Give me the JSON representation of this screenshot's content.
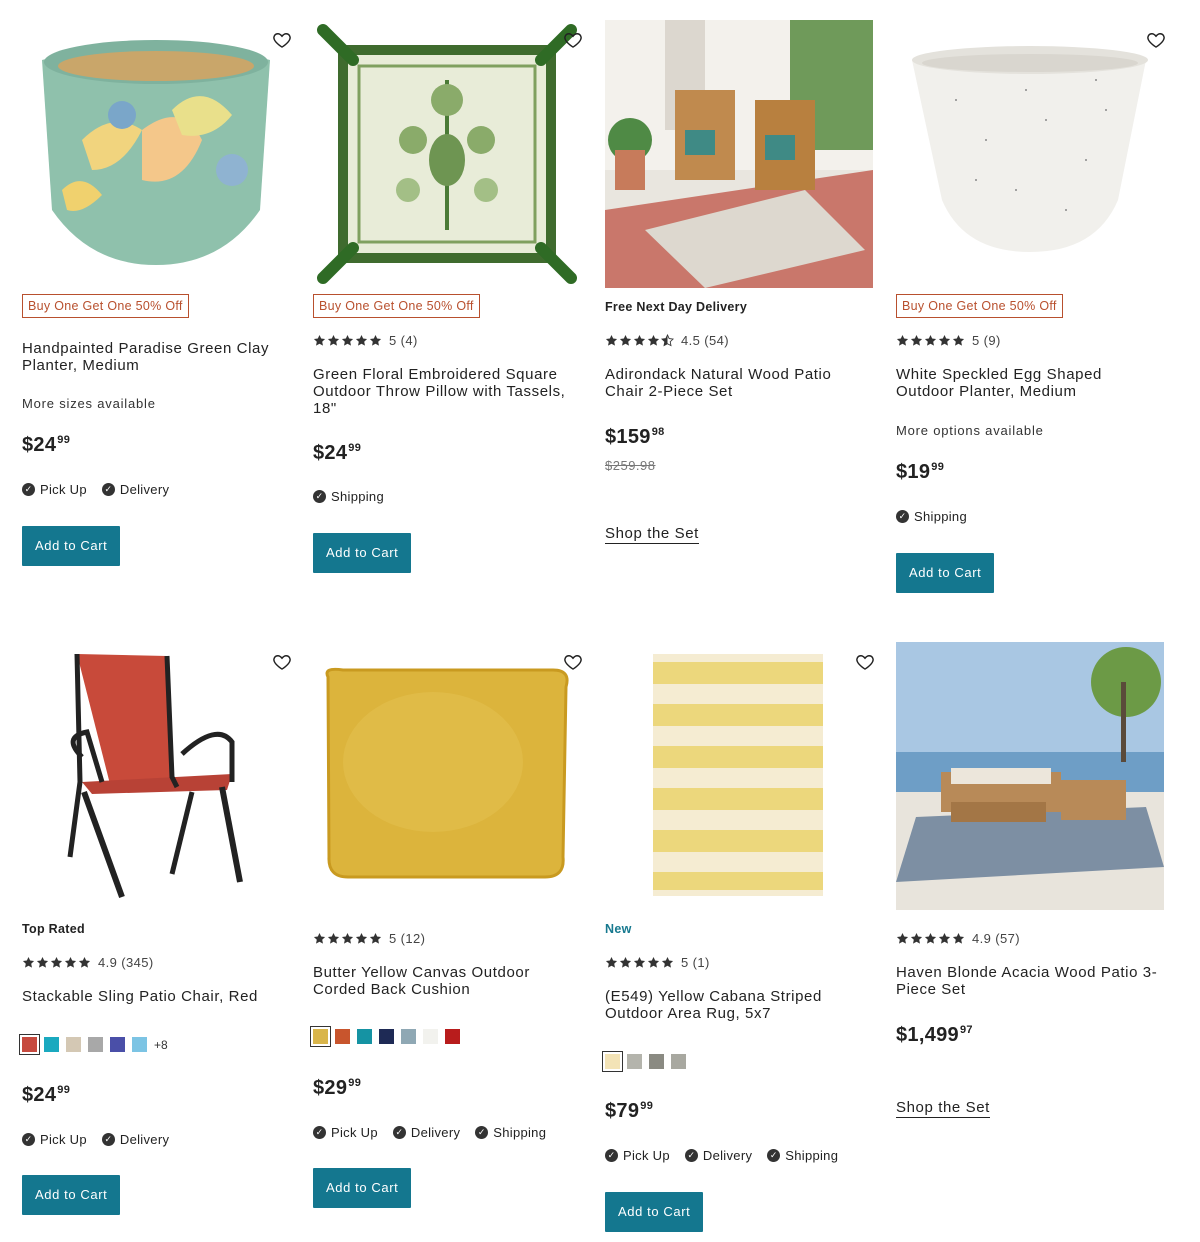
{
  "accent": "#14778f",
  "products": [
    {
      "badge": "Buy One Get One 50% Off",
      "title": "Handpainted Paradise Green Clay Planter, Medium",
      "sub": "More sizes available",
      "price_main": "$24",
      "price_cents": "99",
      "opts": [
        "Pick Up",
        "Delivery"
      ],
      "btn": "Add to Cart",
      "icon": "heart-icon"
    },
    {
      "badge": "Buy One Get One 50% Off",
      "rating_text": "5 (4)",
      "rating": 5,
      "title": "Green Floral Embroidered Square Outdoor Throw Pillow with Tassels, 18\"",
      "price_main": "$24",
      "price_cents": "99",
      "opts": [
        "Shipping"
      ],
      "btn": "Add to Cart",
      "icon": "heart-icon"
    },
    {
      "tag": "Free Next Day Delivery",
      "rating_text": "4.5 (54)",
      "rating": 4.5,
      "title": "Adirondack Natural Wood Patio Chair 2-Piece Set",
      "price_main": "$159",
      "price_cents": "98",
      "old_price": "$259.98",
      "link": "Shop the Set"
    },
    {
      "badge": "Buy One Get One 50% Off",
      "rating_text": "5 (9)",
      "rating": 5,
      "title": "White Speckled Egg Shaped Outdoor Planter, Medium",
      "sub": "More options available",
      "price_main": "$19",
      "price_cents": "99",
      "opts": [
        "Shipping"
      ],
      "btn": "Add to Cart",
      "icon": "heart-icon"
    },
    {
      "tag": "Top Rated",
      "rating_text": "4.9 (345)",
      "rating": 5,
      "title": "Stackable Sling Patio Chair, Red",
      "swatches": [
        "#c64a3f",
        "#1aa9bf",
        "#d4c8b4",
        "#a8a8a8",
        "#4a4fa8",
        "#7cc4e4"
      ],
      "more": "+8",
      "price_main": "$24",
      "price_cents": "99",
      "opts": [
        "Pick Up",
        "Delivery"
      ],
      "btn": "Add to Cart",
      "icon": "heart-icon"
    },
    {
      "rating_text": "5 (12)",
      "rating": 5,
      "title": "Butter Yellow Canvas Outdoor Corded Back Cushion",
      "swatches": [
        "#d9b54a",
        "#c8552d",
        "#1593a3",
        "#1e2a55",
        "#8fa8b4",
        "#f2f2ee",
        "#b81c1c"
      ],
      "price_main": "$29",
      "price_cents": "99",
      "opts": [
        "Pick Up",
        "Delivery",
        "Shipping"
      ],
      "btn": "Add to Cart",
      "icon": "heart-icon"
    },
    {
      "tag": "New",
      "rating_text": "5 (1)",
      "rating": 5,
      "title": "(E549) Yellow Cabana Striped Outdoor Area Rug, 5x7",
      "swatches": [
        "#f3e3b6",
        "#b4b4ac",
        "#8a8a82",
        "#a8a8a0"
      ],
      "price_main": "$79",
      "price_cents": "99",
      "opts": [
        "Pick Up",
        "Delivery",
        "Shipping"
      ],
      "btn": "Add to Cart",
      "icon": "heart-icon"
    },
    {
      "rating_text": "4.9 (57)",
      "rating": 5,
      "title": "Haven Blonde Acacia Wood Patio 3-Piece Set",
      "price_main": "$1,499",
      "price_cents": "97",
      "link": "Shop the Set"
    }
  ]
}
